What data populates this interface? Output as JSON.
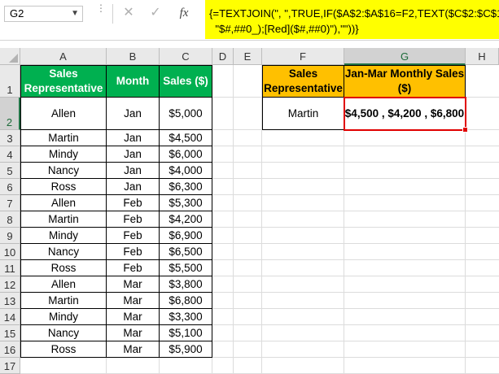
{
  "formula_bar": {
    "name_box": "G2",
    "cancel_icon": "✕",
    "enter_icon": "✓",
    "fx_label": "fx",
    "formula_line1": "{=TEXTJOIN(\", \",TRUE,IF($A$2:$A$16=F2,TEXT($C$2:$C$16,",
    "formula_line2": "  \"$#,##0_);[Red]($#,##0)\"),\"\"))}",
    "formula_highlight": "#ffff00"
  },
  "columns": [
    "A",
    "B",
    "C",
    "D",
    "E",
    "F",
    "G",
    "H"
  ],
  "selected_column": "G",
  "row_numbers": [
    "1",
    "2",
    "3",
    "4",
    "5",
    "6",
    "7",
    "8",
    "9",
    "10",
    "11",
    "12",
    "13",
    "14",
    "15",
    "16",
    "17"
  ],
  "selected_row": "2",
  "table": {
    "headers": [
      "Sales Representative",
      "Month",
      "Sales ($)"
    ],
    "header_color": "#00b050",
    "rows": [
      [
        "Allen",
        "Jan",
        "$5,000"
      ],
      [
        "Martin",
        "Jan",
        "$4,500"
      ],
      [
        "Mindy",
        "Jan",
        "$6,000"
      ],
      [
        "Nancy",
        "Jan",
        "$4,000"
      ],
      [
        "Ross",
        "Jan",
        "$6,300"
      ],
      [
        "Allen",
        "Feb",
        "$5,300"
      ],
      [
        "Martin",
        "Feb",
        "$4,200"
      ],
      [
        "Mindy",
        "Feb",
        "$6,900"
      ],
      [
        "Nancy",
        "Feb",
        "$6,500"
      ],
      [
        "Ross",
        "Feb",
        "$5,500"
      ],
      [
        "Allen",
        "Mar",
        "$3,800"
      ],
      [
        "Martin",
        "Mar",
        "$6,800"
      ],
      [
        "Mindy",
        "Mar",
        "$3,300"
      ],
      [
        "Nancy",
        "Mar",
        "$5,100"
      ],
      [
        "Ross",
        "Mar",
        "$5,900"
      ]
    ]
  },
  "lookup": {
    "header_rep": "Sales Representative",
    "header_sales": "Jan-Mar Monthly Sales ($)",
    "header_color": "#ffc000",
    "rep": "Martin",
    "result": "$4,500 , $4,200 , $6,800",
    "selection_color": "#e00000"
  }
}
